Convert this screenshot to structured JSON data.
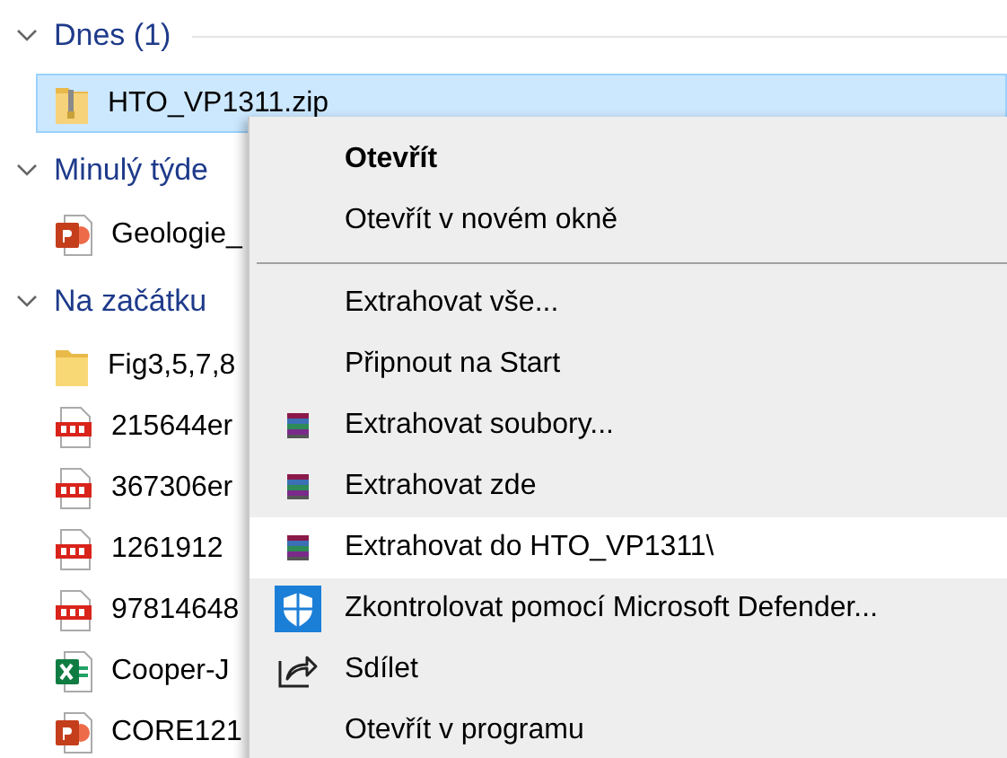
{
  "file_list": {
    "groups": [
      {
        "title": "Dnes (1)",
        "expanded": true,
        "files": [
          {
            "name": "HTO_VP1311.zip",
            "kind": "zip",
            "selected": true
          }
        ]
      },
      {
        "title": "Minulý týde",
        "expanded": true,
        "files": [
          {
            "name": "Geologie_",
            "kind": "pptx",
            "selected": false
          }
        ]
      },
      {
        "title": "Na začátku",
        "expanded": true,
        "files": [
          {
            "name": "Fig3,5,7,8",
            "kind": "folder",
            "selected": false
          },
          {
            "name": "215644er",
            "kind": "pdf",
            "selected": false
          },
          {
            "name": "367306er",
            "kind": "pdf",
            "selected": false
          },
          {
            "name": "1261912",
            "kind": "pdf",
            "selected": false
          },
          {
            "name": "97814648",
            "kind": "pdf",
            "selected": false
          },
          {
            "name": "Cooper-J",
            "kind": "xlsx",
            "selected": false
          },
          {
            "name": "CORE121",
            "kind": "pptx",
            "selected": false
          }
        ]
      }
    ]
  },
  "context_menu": {
    "items": [
      {
        "label": "Otevřít",
        "kind": "plain",
        "default": true,
        "highlighted": false
      },
      {
        "label": "Otevřít v novém okně",
        "kind": "plain",
        "default": false,
        "highlighted": false
      },
      {
        "kind": "separator"
      },
      {
        "label": "Extrahovat vše...",
        "kind": "plain",
        "default": false,
        "highlighted": false
      },
      {
        "label": "Připnout na Start",
        "kind": "plain",
        "default": false,
        "highlighted": false
      },
      {
        "label": "Extrahovat soubory...",
        "kind": "archiver",
        "default": false,
        "highlighted": false
      },
      {
        "label": "Extrahovat zde",
        "kind": "archiver",
        "default": false,
        "highlighted": false
      },
      {
        "label": "Extrahovat do HTO_VP1311\\",
        "kind": "archiver",
        "default": false,
        "highlighted": true
      },
      {
        "label": "Zkontrolovat pomocí Microsoft Defender...",
        "kind": "defender",
        "default": false,
        "highlighted": false
      },
      {
        "label": "Sdílet",
        "kind": "share",
        "default": false,
        "highlighted": false
      },
      {
        "label": "Otevřít v programu",
        "kind": "plain",
        "default": false,
        "highlighted": false
      }
    ]
  }
}
